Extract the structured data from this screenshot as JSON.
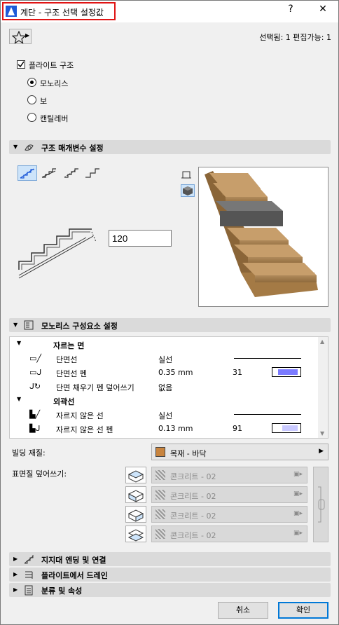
{
  "window": {
    "title": "계단 - 구조 선택 설정값",
    "help": "?",
    "close": "✕"
  },
  "header": {
    "selection_info": "선택됨: 1 편집가능: 1"
  },
  "flight": {
    "checkbox_label": "플라이트 구조",
    "options": [
      "모노리스",
      "보",
      "캔틸레버"
    ],
    "selected": "모노리스"
  },
  "param_section": {
    "title": "구조 매개변수 설정",
    "thickness_value": "120"
  },
  "monolith_section": {
    "title": "모노리스 구성요소 설정",
    "groups": [
      {
        "label": "자르는 면"
      },
      {
        "label": "외곽선"
      }
    ],
    "rows": [
      {
        "name": "단면선",
        "value": "실선",
        "num": ""
      },
      {
        "name": "단면선 펜",
        "value": "0.35 mm",
        "num": "31"
      },
      {
        "name": "단면 채우기 펜 덮어쓰기",
        "value": "없음",
        "num": ""
      },
      {
        "name": "자르지 않은 선",
        "value": "실선",
        "num": ""
      },
      {
        "name": "자르지 않은 선 펜",
        "value": "0.13 mm",
        "num": "91"
      }
    ]
  },
  "material": {
    "building_label": "빌딩 재질:",
    "building_value": "목재 - 바닥",
    "surface_label": "표면질 덮어쓰기:",
    "surfaces": [
      "콘크리트 - 02",
      "콘크리트 - 02",
      "콘크리트 - 02",
      "콘크리트 - 02"
    ]
  },
  "collapsed_sections": [
    "지지대 엔딩 및 연결",
    "플라이트에서 드레인",
    "분류 및 속성"
  ],
  "footer": {
    "cancel": "취소",
    "ok": "확인"
  },
  "colors": {
    "accent": "#0078d7",
    "title_highlight": "#e01414",
    "pen_swatch": "#7b7bff"
  }
}
